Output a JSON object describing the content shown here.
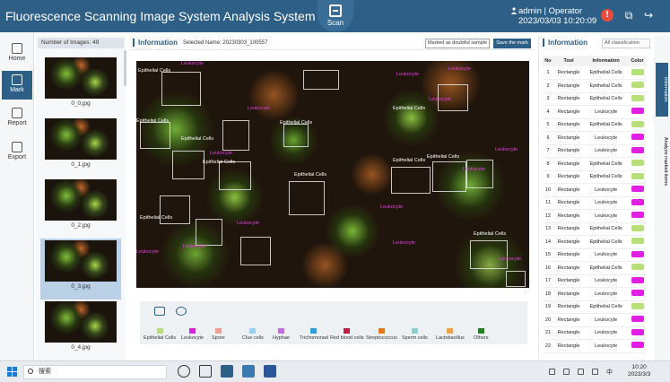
{
  "app": {
    "title": "Fluorescence Scanning Image System Analysis System",
    "scan_label": "Scan"
  },
  "user": {
    "name": "admin",
    "role": "Operator",
    "datetime": "2023/03/03  10:20:09"
  },
  "nav": [
    {
      "label": "Home"
    },
    {
      "label": "Mark",
      "active": true
    },
    {
      "label": "Report"
    },
    {
      "label": "Export"
    }
  ],
  "imagelist": {
    "header": "Number of Images: 49",
    "items": [
      "0_0.jpg",
      "0_1.jpg",
      "0_2.jpg",
      "0_3.jpg",
      "0_4.jpg"
    ],
    "selected_index": 3
  },
  "viewer": {
    "title": "Information",
    "subtitle": "Selected Name: 20230303_100557",
    "doubt_btn": "Marked as doubtful sample",
    "save_btn": "Save the mark",
    "labels": {
      "epi": "Epithelial Cells",
      "leuko": "Leukocyte"
    }
  },
  "legend": [
    {
      "label": "Epithelial Cells",
      "color": "#b7e07a"
    },
    {
      "label": "Leukocyte",
      "color": "#e020e0"
    },
    {
      "label": "Spore",
      "color": "#f0a090"
    },
    {
      "label": "Clue cells",
      "color": "#9ad0f0"
    },
    {
      "label": "Hyphae",
      "color": "#c070e0"
    },
    {
      "label": "Trichomonad",
      "color": "#2aa0e0"
    },
    {
      "label": "Red blood cells",
      "color": "#c02040"
    },
    {
      "label": "Streptococcus",
      "color": "#e07a20"
    },
    {
      "label": "Sperm cells",
      "color": "#90d0d0"
    },
    {
      "label": "Lactobacillus",
      "color": "#f0a040"
    },
    {
      "label": "Others",
      "color": "#208020"
    }
  ],
  "info": {
    "title": "Information",
    "filter": "All classification",
    "headers": [
      "No",
      "Tool",
      "Information",
      "Color"
    ],
    "rows": [
      {
        "no": "1",
        "tool": "Rectangle",
        "info": "Epithelial Cells",
        "color": "#b7e07a"
      },
      {
        "no": "2",
        "tool": "Rectangle",
        "info": "Epithelial Cells",
        "color": "#b7e07a"
      },
      {
        "no": "3",
        "tool": "Rectangle",
        "info": "Epithelial Cells",
        "color": "#b7e07a"
      },
      {
        "no": "4",
        "tool": "Rectangle",
        "info": "Leukocyte",
        "color": "#e020e0"
      },
      {
        "no": "5",
        "tool": "Rectangle",
        "info": "Epithelial Cells",
        "color": "#b7e07a"
      },
      {
        "no": "6",
        "tool": "Rectangle",
        "info": "Leukocyte",
        "color": "#e020e0"
      },
      {
        "no": "7",
        "tool": "Rectangle",
        "info": "Leukocyte",
        "color": "#e020e0"
      },
      {
        "no": "8",
        "tool": "Rectangle",
        "info": "Epithelial Cells",
        "color": "#b7e07a"
      },
      {
        "no": "9",
        "tool": "Rectangle",
        "info": "Epithelial Cells",
        "color": "#b7e07a"
      },
      {
        "no": "10",
        "tool": "Rectangle",
        "info": "Leukocyte",
        "color": "#e020e0"
      },
      {
        "no": "11",
        "tool": "Rectangle",
        "info": "Leukocyte",
        "color": "#e020e0"
      },
      {
        "no": "12",
        "tool": "Rectangle",
        "info": "Leukocyte",
        "color": "#e020e0"
      },
      {
        "no": "13",
        "tool": "Rectangle",
        "info": "Epithelial Cells",
        "color": "#b7e07a"
      },
      {
        "no": "14",
        "tool": "Rectangle",
        "info": "Epithelial Cells",
        "color": "#b7e07a"
      },
      {
        "no": "15",
        "tool": "Rectangle",
        "info": "Leukocyte",
        "color": "#e020e0"
      },
      {
        "no": "16",
        "tool": "Rectangle",
        "info": "Epithelial Cells",
        "color": "#b7e07a"
      },
      {
        "no": "17",
        "tool": "Rectangle",
        "info": "Leukocyte",
        "color": "#e020e0"
      },
      {
        "no": "18",
        "tool": "Rectangle",
        "info": "Leukocyte",
        "color": "#e020e0"
      },
      {
        "no": "19",
        "tool": "Rectangle",
        "info": "Epithelial Cells",
        "color": "#b7e07a"
      },
      {
        "no": "20",
        "tool": "Rectangle",
        "info": "Leukocyte",
        "color": "#e020e0"
      },
      {
        "no": "21",
        "tool": "Rectangle",
        "info": "Leukocyte",
        "color": "#e020e0"
      },
      {
        "no": "22",
        "tool": "Rectangle",
        "info": "Leukocyte",
        "color": "#e020e0"
      }
    ]
  },
  "rail": [
    "Information",
    "Analyze marked items"
  ],
  "taskbar": {
    "search": "搜索",
    "lang": "中",
    "time": "10:20",
    "date": "2023/3/3"
  }
}
